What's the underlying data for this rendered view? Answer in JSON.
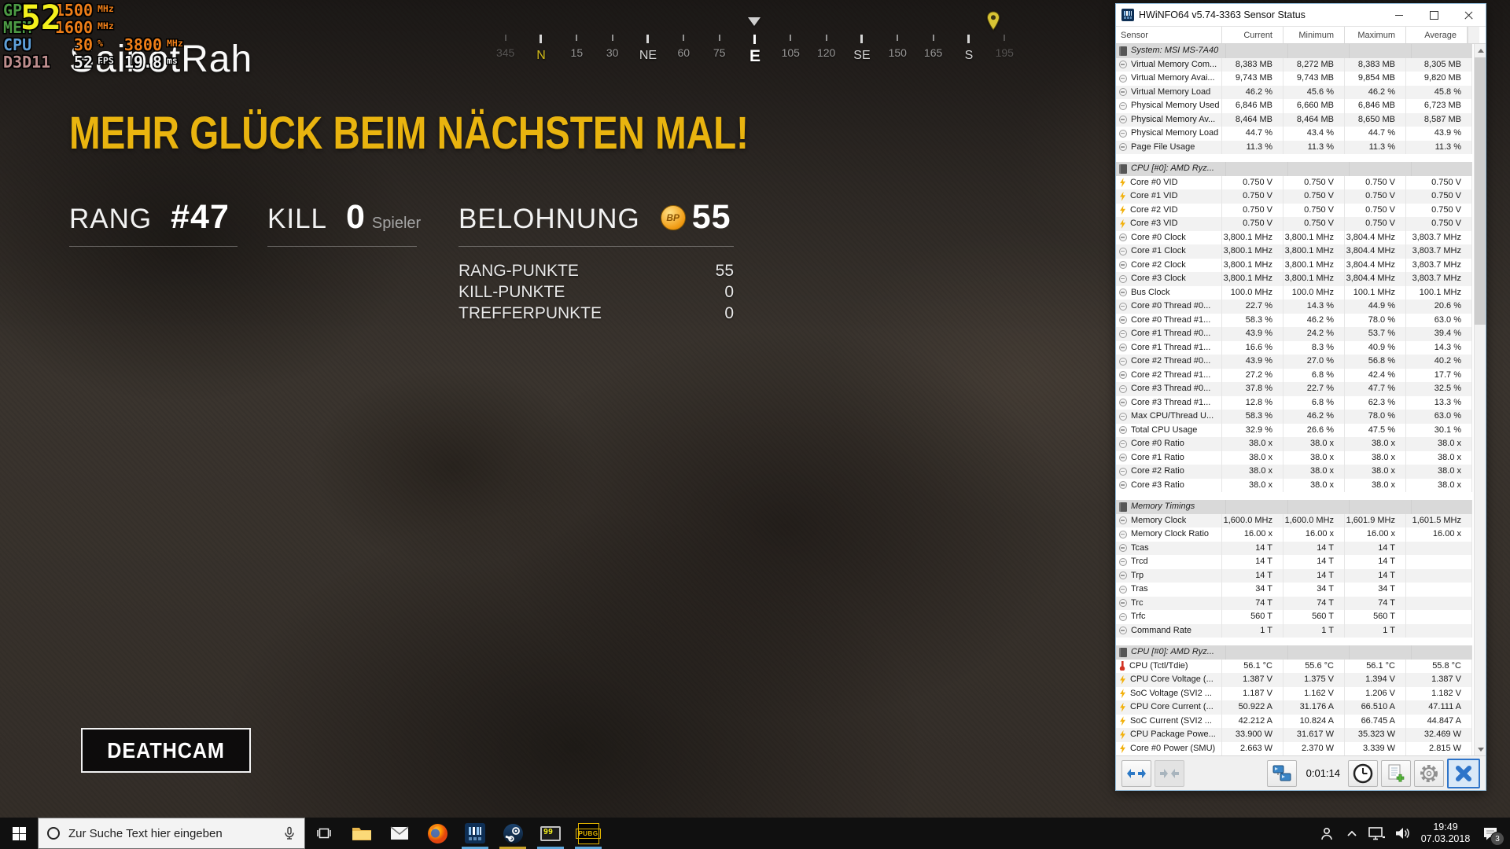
{
  "osd": {
    "fps_large": "52",
    "gpu": {
      "label": "GPU",
      "clock": "1500",
      "clock_unit": "MHz"
    },
    "mem": {
      "label": "MEM",
      "clock": "1600",
      "clock_unit": "MHz"
    },
    "cpu": {
      "label": "CPU",
      "usage": "30",
      "usage_unit": "%",
      "clock": "3800",
      "clock_unit": "MHz"
    },
    "api": {
      "label": "D3D11",
      "fps": "52",
      "fps_unit": "FPS",
      "frametime": "19.8",
      "frametime_unit": "ms"
    },
    "colors": {
      "label_green": "#4c9a44",
      "label_blue": "#5e9fd8",
      "label_rose": "#bd8d8d",
      "value_orange": "#ee7e18",
      "fps_yellow": "#f4f11c"
    }
  },
  "compass": {
    "labels": [
      {
        "text": "345",
        "type": "minor",
        "fade": true
      },
      {
        "text": "N",
        "type": "major",
        "accent": true
      },
      {
        "text": "15",
        "type": "minor"
      },
      {
        "text": "30",
        "type": "minor"
      },
      {
        "text": "NE",
        "type": "major"
      },
      {
        "text": "60",
        "type": "minor"
      },
      {
        "text": "75",
        "type": "minor"
      },
      {
        "text": "E",
        "type": "center"
      },
      {
        "text": "105",
        "type": "minor"
      },
      {
        "text": "120",
        "type": "minor"
      },
      {
        "text": "SE",
        "type": "major"
      },
      {
        "text": "150",
        "type": "minor"
      },
      {
        "text": "165",
        "type": "minor"
      },
      {
        "text": "S",
        "type": "major"
      },
      {
        "text": "195",
        "type": "minor",
        "fade": true
      }
    ]
  },
  "match": {
    "player_name": "SaibotRah",
    "headline": "MEHR GLÜCK BEIM NÄCHSTEN MAL!",
    "rank_label": "RANG",
    "rank_value": "#47",
    "kill_label": "KILL",
    "kill_value": "0",
    "kill_suffix": "Spieler",
    "reward_label": "BELOHNUNG",
    "reward_value": "55",
    "coin_text": "BP",
    "points": [
      {
        "label": "RANG-PUNKTE",
        "value": "55"
      },
      {
        "label": "KILL-PUNKTE",
        "value": "0"
      },
      {
        "label": "TREFFERPUNKTE",
        "value": "0"
      }
    ],
    "deathcam_label": "DEATHCAM"
  },
  "hwinfo": {
    "title": "HWiNFO64 v5.74-3363 Sensor Status",
    "columns": [
      "Sensor",
      "Current",
      "Minimum",
      "Maximum",
      "Average"
    ],
    "toolbar": {
      "uptime": "0:01:14"
    },
    "sections": [
      {
        "header": "System: MSI MS-7A40",
        "rows": [
          {
            "icon": "gauge",
            "label": "Virtual Memory Com...",
            "values": [
              "8,383 MB",
              "8,272 MB",
              "8,383 MB",
              "8,305 MB"
            ]
          },
          {
            "icon": "gauge",
            "label": "Virtual Memory Avai...",
            "values": [
              "9,743 MB",
              "9,743 MB",
              "9,854 MB",
              "9,820 MB"
            ]
          },
          {
            "icon": "gauge",
            "label": "Virtual Memory Load",
            "values": [
              "46.2 %",
              "45.6 %",
              "46.2 %",
              "45.8 %"
            ]
          },
          {
            "icon": "gauge",
            "label": "Physical Memory Used",
            "values": [
              "6,846 MB",
              "6,660 MB",
              "6,846 MB",
              "6,723 MB"
            ]
          },
          {
            "icon": "gauge",
            "label": "Physical Memory Av...",
            "values": [
              "8,464 MB",
              "8,464 MB",
              "8,650 MB",
              "8,587 MB"
            ]
          },
          {
            "icon": "gauge",
            "label": "Physical Memory Load",
            "values": [
              "44.7 %",
              "43.4 %",
              "44.7 %",
              "43.9 %"
            ]
          },
          {
            "icon": "gauge",
            "label": "Page File Usage",
            "values": [
              "11.3 %",
              "11.3 %",
              "11.3 %",
              "11.3 %"
            ]
          }
        ]
      },
      {
        "header": "CPU [#0]: AMD Ryz...",
        "rows": [
          {
            "icon": "bolt",
            "label": "Core #0 VID",
            "values": [
              "0.750 V",
              "0.750 V",
              "0.750 V",
              "0.750 V"
            ]
          },
          {
            "icon": "bolt",
            "label": "Core #1 VID",
            "values": [
              "0.750 V",
              "0.750 V",
              "0.750 V",
              "0.750 V"
            ]
          },
          {
            "icon": "bolt",
            "label": "Core #2 VID",
            "values": [
              "0.750 V",
              "0.750 V",
              "0.750 V",
              "0.750 V"
            ]
          },
          {
            "icon": "bolt",
            "label": "Core #3 VID",
            "values": [
              "0.750 V",
              "0.750 V",
              "0.750 V",
              "0.750 V"
            ]
          },
          {
            "icon": "gauge",
            "label": "Core #0 Clock",
            "values": [
              "3,800.1 MHz",
              "3,800.1 MHz",
              "3,804.4 MHz",
              "3,803.7 MHz"
            ]
          },
          {
            "icon": "gauge",
            "label": "Core #1 Clock",
            "values": [
              "3,800.1 MHz",
              "3,800.1 MHz",
              "3,804.4 MHz",
              "3,803.7 MHz"
            ]
          },
          {
            "icon": "gauge",
            "label": "Core #2 Clock",
            "values": [
              "3,800.1 MHz",
              "3,800.1 MHz",
              "3,804.4 MHz",
              "3,803.7 MHz"
            ]
          },
          {
            "icon": "gauge",
            "label": "Core #3 Clock",
            "values": [
              "3,800.1 MHz",
              "3,800.1 MHz",
              "3,804.4 MHz",
              "3,803.7 MHz"
            ]
          },
          {
            "icon": "gauge",
            "label": "Bus Clock",
            "values": [
              "100.0 MHz",
              "100.0 MHz",
              "100.1 MHz",
              "100.1 MHz"
            ]
          },
          {
            "icon": "gauge",
            "label": "Core #0 Thread #0...",
            "values": [
              "22.7 %",
              "14.3 %",
              "44.9 %",
              "20.6 %"
            ]
          },
          {
            "icon": "gauge",
            "label": "Core #0 Thread #1...",
            "values": [
              "58.3 %",
              "46.2 %",
              "78.0 %",
              "63.0 %"
            ]
          },
          {
            "icon": "gauge",
            "label": "Core #1 Thread #0...",
            "values": [
              "43.9 %",
              "24.2 %",
              "53.7 %",
              "39.4 %"
            ]
          },
          {
            "icon": "gauge",
            "label": "Core #1 Thread #1...",
            "values": [
              "16.6 %",
              "8.3 %",
              "40.9 %",
              "14.3 %"
            ]
          },
          {
            "icon": "gauge",
            "label": "Core #2 Thread #0...",
            "values": [
              "43.9 %",
              "27.0 %",
              "56.8 %",
              "40.2 %"
            ]
          },
          {
            "icon": "gauge",
            "label": "Core #2 Thread #1...",
            "values": [
              "27.2 %",
              "6.8 %",
              "42.4 %",
              "17.7 %"
            ]
          },
          {
            "icon": "gauge",
            "label": "Core #3 Thread #0...",
            "values": [
              "37.8 %",
              "22.7 %",
              "47.7 %",
              "32.5 %"
            ]
          },
          {
            "icon": "gauge",
            "label": "Core #3 Thread #1...",
            "values": [
              "12.8 %",
              "6.8 %",
              "62.3 %",
              "13.3 %"
            ]
          },
          {
            "icon": "gauge",
            "label": "Max CPU/Thread U...",
            "values": [
              "58.3 %",
              "46.2 %",
              "78.0 %",
              "63.0 %"
            ]
          },
          {
            "icon": "gauge",
            "label": "Total CPU Usage",
            "values": [
              "32.9 %",
              "26.6 %",
              "47.5 %",
              "30.1 %"
            ]
          },
          {
            "icon": "gauge",
            "label": "Core #0 Ratio",
            "values": [
              "38.0 x",
              "38.0 x",
              "38.0 x",
              "38.0 x"
            ]
          },
          {
            "icon": "gauge",
            "label": "Core #1 Ratio",
            "values": [
              "38.0 x",
              "38.0 x",
              "38.0 x",
              "38.0 x"
            ]
          },
          {
            "icon": "gauge",
            "label": "Core #2 Ratio",
            "values": [
              "38.0 x",
              "38.0 x",
              "38.0 x",
              "38.0 x"
            ]
          },
          {
            "icon": "gauge",
            "label": "Core #3 Ratio",
            "values": [
              "38.0 x",
              "38.0 x",
              "38.0 x",
              "38.0 x"
            ]
          }
        ]
      },
      {
        "header": "Memory Timings",
        "rows": [
          {
            "icon": "gauge",
            "label": "Memory Clock",
            "values": [
              "1,600.0 MHz",
              "1,600.0 MHz",
              "1,601.9 MHz",
              "1,601.5 MHz"
            ]
          },
          {
            "icon": "gauge",
            "label": "Memory Clock Ratio",
            "values": [
              "16.00 x",
              "16.00 x",
              "16.00 x",
              "16.00 x"
            ]
          },
          {
            "icon": "gauge",
            "label": "Tcas",
            "values": [
              "14 T",
              "14 T",
              "14 T",
              ""
            ]
          },
          {
            "icon": "gauge",
            "label": "Trcd",
            "values": [
              "14 T",
              "14 T",
              "14 T",
              ""
            ]
          },
          {
            "icon": "gauge",
            "label": "Trp",
            "values": [
              "14 T",
              "14 T",
              "14 T",
              ""
            ]
          },
          {
            "icon": "gauge",
            "label": "Tras",
            "values": [
              "34 T",
              "34 T",
              "34 T",
              ""
            ]
          },
          {
            "icon": "gauge",
            "label": "Trc",
            "values": [
              "74 T",
              "74 T",
              "74 T",
              ""
            ]
          },
          {
            "icon": "gauge",
            "label": "Trfc",
            "values": [
              "560 T",
              "560 T",
              "560 T",
              ""
            ]
          },
          {
            "icon": "gauge",
            "label": "Command Rate",
            "values": [
              "1 T",
              "1 T",
              "1 T",
              ""
            ]
          }
        ]
      },
      {
        "header": "CPU [#0]: AMD Ryz...",
        "rows": [
          {
            "icon": "temp",
            "label": "CPU (Tctl/Tdie)",
            "values": [
              "56.1 °C",
              "55.6 °C",
              "56.1 °C",
              "55.8 °C"
            ]
          },
          {
            "icon": "bolt",
            "label": "CPU Core Voltage (...",
            "values": [
              "1.387 V",
              "1.375 V",
              "1.394 V",
              "1.387 V"
            ]
          },
          {
            "icon": "bolt",
            "label": "SoC Voltage (SVI2 ...",
            "values": [
              "1.187 V",
              "1.162 V",
              "1.206 V",
              "1.182 V"
            ]
          },
          {
            "icon": "bolt",
            "label": "CPU Core Current (...",
            "values": [
              "50.922 A",
              "31.176 A",
              "66.510 A",
              "47.111 A"
            ]
          },
          {
            "icon": "bolt",
            "label": "SoC Current (SVI2 ...",
            "values": [
              "42.212 A",
              "10.824 A",
              "66.745 A",
              "44.847 A"
            ]
          },
          {
            "icon": "bolt",
            "label": "CPU Package Powe...",
            "values": [
              "33.900 W",
              "31.617 W",
              "35.323 W",
              "32.469 W"
            ]
          },
          {
            "icon": "bolt",
            "label": "Core #0 Power (SMU)",
            "values": [
              "2.663 W",
              "2.370 W",
              "3.339 W",
              "2.815 W"
            ]
          }
        ]
      }
    ]
  },
  "taskbar": {
    "search_placeholder": "Zur Suche Text hier eingeben",
    "afterburner_badge": "99",
    "pubg_label": "PUBG",
    "tray": {
      "time": "19:49",
      "date": "07.03.2018",
      "notification_count": "3"
    }
  }
}
